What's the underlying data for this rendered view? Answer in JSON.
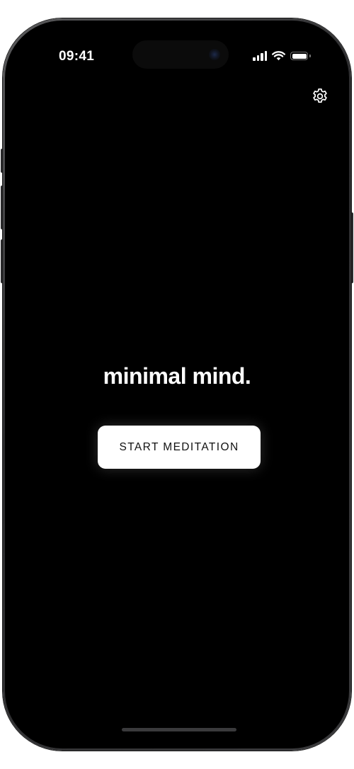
{
  "status_bar": {
    "time": "09:41"
  },
  "main": {
    "title": "minimal mind.",
    "start_button_label": "START MEDITATION"
  },
  "icons": {
    "settings": "gear-icon",
    "signal": "cellular-signal-icon",
    "wifi": "wifi-icon",
    "battery": "battery-icon"
  },
  "colors": {
    "background": "#000000",
    "text": "#ffffff",
    "button_background": "#ffffff",
    "button_text": "#111111"
  }
}
